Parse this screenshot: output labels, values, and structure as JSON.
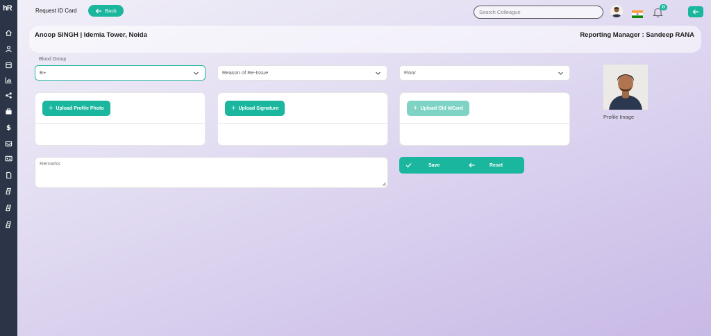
{
  "app": {
    "logo_text": "hR"
  },
  "header": {
    "title": "Request ID Card",
    "back_label": "Back",
    "search_placeholder": "Search Colleague",
    "notification_count": "0"
  },
  "sidebar": {
    "items": [
      {
        "icon": "home-icon"
      },
      {
        "icon": "user-icon"
      },
      {
        "icon": "calendar-icon"
      },
      {
        "icon": "bar-chart-icon"
      },
      {
        "icon": "share-icon"
      },
      {
        "icon": "briefcase-icon"
      },
      {
        "icon": "dollar-icon"
      },
      {
        "icon": "inbox-icon"
      },
      {
        "icon": "id-card-icon"
      },
      {
        "icon": "document-icon"
      },
      {
        "icon": "tag-icon"
      },
      {
        "icon": "tag-icon"
      },
      {
        "icon": "tag-icon"
      }
    ]
  },
  "employee": {
    "info": "Anoop SINGH | Idemia Tower, Noida",
    "manager": "Reporting Manager : Sandeep RANA"
  },
  "form": {
    "blood_group_label": "Blood Group",
    "blood_group_value": "B+",
    "reason_placeholder": "Reason of Re-Issue",
    "floor_placeholder": "Floor",
    "upload_photo_label": "Upload Profile Photo",
    "upload_signature_label": "Upload Signature",
    "upload_old_id_label": "Upload Old IdCard",
    "remarks_placeholder": "Remarks",
    "save_label": "Save",
    "reset_label": "Reset"
  },
  "profile": {
    "image_label": "Profile Image"
  },
  "colors": {
    "accent": "#1ab69d",
    "sidebar": "#2b3547",
    "accent_disabled": "#7fd3c4"
  }
}
